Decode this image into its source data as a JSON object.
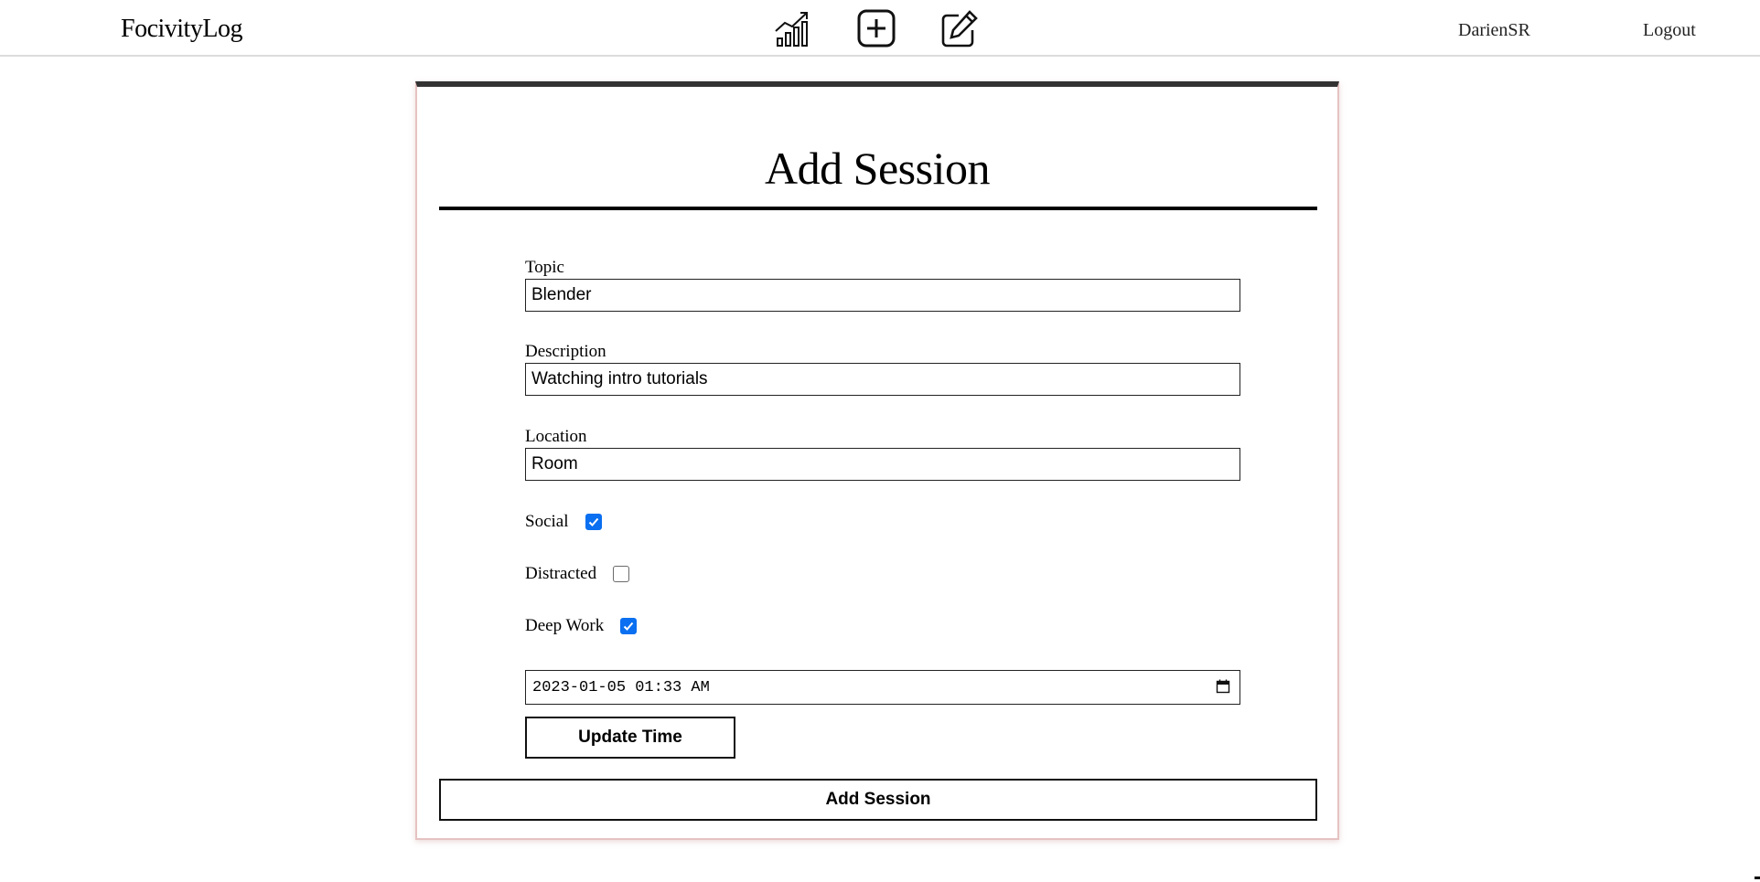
{
  "header": {
    "brand": "FocivityLog",
    "icons": [
      "stats-chart-icon",
      "add-square-icon",
      "edit-note-icon"
    ],
    "username": "DarienSR",
    "logout_label": "Logout"
  },
  "form": {
    "title": "Add Session",
    "topic": {
      "label": "Topic",
      "value": "Blender"
    },
    "description": {
      "label": "Description",
      "value": "Watching intro tutorials"
    },
    "location": {
      "label": "Location",
      "value": "Room"
    },
    "social": {
      "label": "Social",
      "checked": true
    },
    "distracted": {
      "label": "Distracted",
      "checked": false
    },
    "deep_work": {
      "label": "Deep Work",
      "checked": true
    },
    "datetime_value": "2023-01-05 01:33 AM",
    "update_time_label": "Update Time",
    "submit_label": "Add Session"
  },
  "colors": {
    "checkbox_accent": "#0a6ff0",
    "card_border": "#e6c2c2",
    "card_top_border": "#333333"
  }
}
